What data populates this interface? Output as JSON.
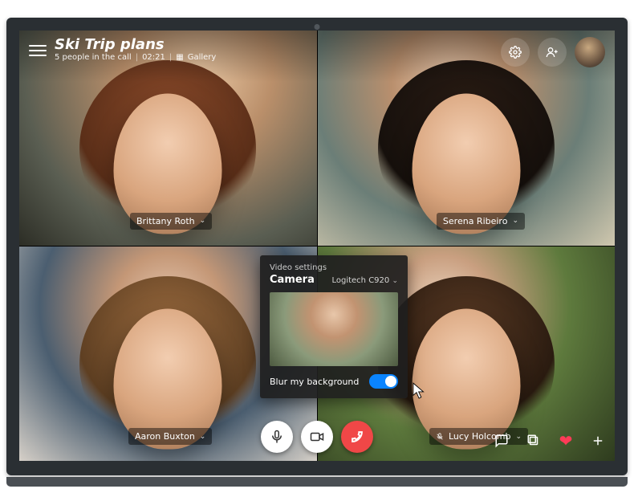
{
  "header": {
    "title": "Ski Trip plans",
    "subtitle_people": "5 people in the call",
    "subtitle_time": "02:21",
    "subtitle_view": "Gallery"
  },
  "header_buttons": {
    "settings_icon": "gear-icon",
    "add_person_icon": "add-person-icon"
  },
  "participants": [
    {
      "name": "Brittany Roth"
    },
    {
      "name": "Serena Ribeiro"
    },
    {
      "name": "Aaron Buxton"
    },
    {
      "name": "Lucy Holcomb"
    }
  ],
  "video_settings": {
    "panel_title": "Video settings",
    "section_label": "Camera",
    "device_name": "Logitech C920",
    "blur_label": "Blur my background",
    "blur_enabled": true
  },
  "controls": {
    "mic": "microphone-icon",
    "camera": "camera-icon",
    "end": "end-call-icon"
  },
  "right_controls": {
    "chat": "chat-icon",
    "share": "share-screen-icon",
    "react": "heart-icon",
    "more": "plus-icon"
  }
}
